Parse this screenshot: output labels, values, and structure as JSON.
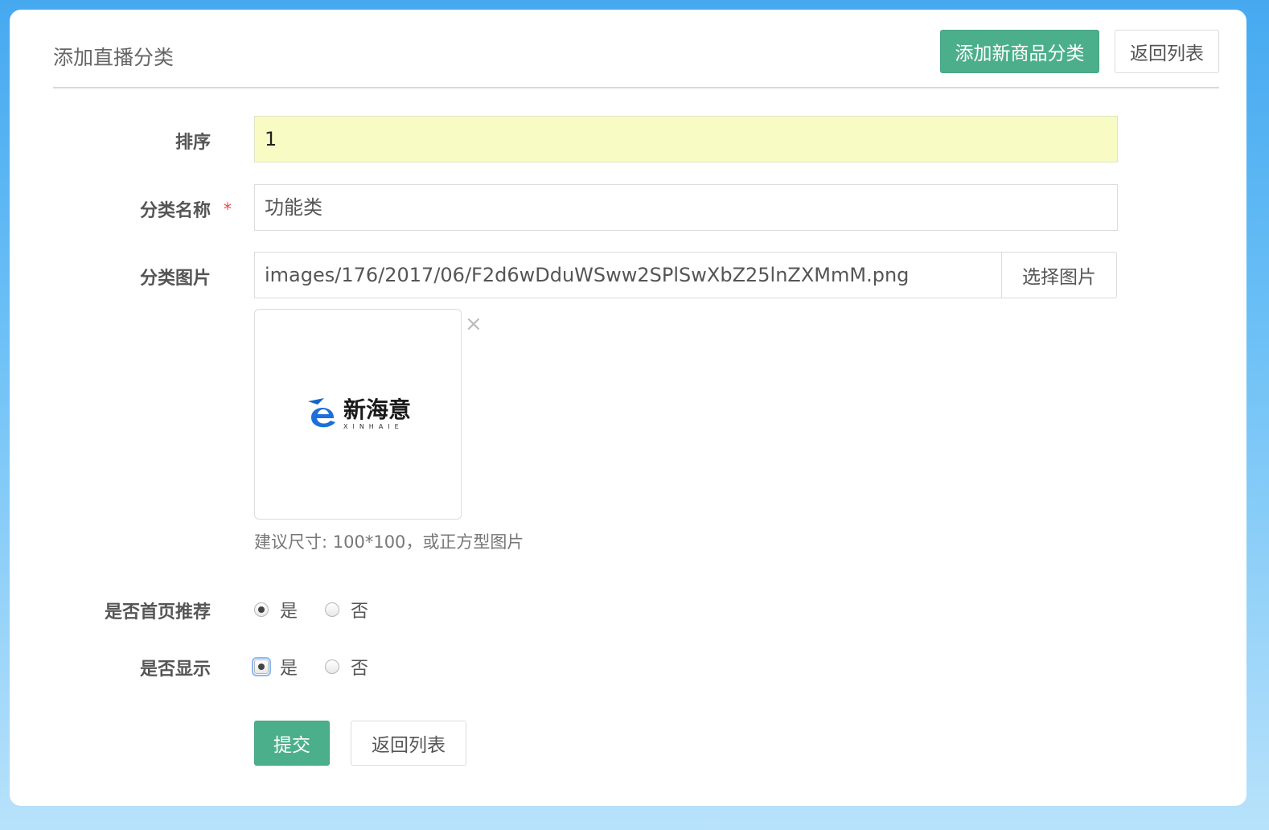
{
  "header": {
    "title": "添加直播分类",
    "add_button": "添加新商品分类",
    "back_button": "返回列表"
  },
  "form": {
    "sort": {
      "label": "排序",
      "value": "1"
    },
    "name": {
      "label": "分类名称",
      "required_mark": "*",
      "value": "功能类"
    },
    "image": {
      "label": "分类图片",
      "path": "images/176/2017/06/F2d6wDduWSww2SPlSwXbZ25lnZXMmM.png",
      "select_button": "选择图片",
      "remove_glyph": "×",
      "logo_text": "新海意",
      "logo_subtext": "XINHAIE",
      "hint": "建议尺寸: 100*100，或正方型图片"
    },
    "homepage_recommend": {
      "label": "是否首页推荐",
      "options": [
        "是",
        "否"
      ],
      "selected": "是"
    },
    "display": {
      "label": "是否显示",
      "options": [
        "是",
        "否"
      ],
      "selected": "是"
    },
    "submit_button": "提交",
    "back_button": "返回列表"
  },
  "colors": {
    "primary_green": "#4caf8c",
    "highlight_input": "#f9fbc5",
    "frame_blue": "#46a9f0"
  }
}
